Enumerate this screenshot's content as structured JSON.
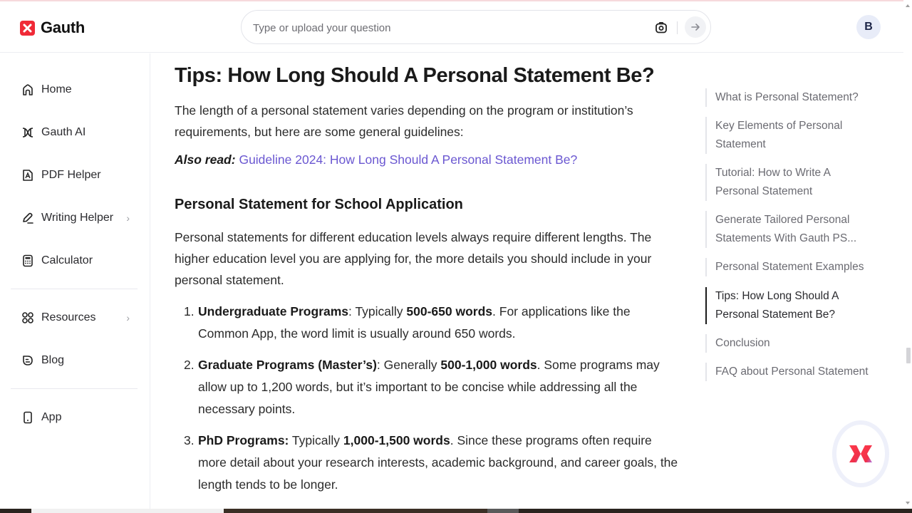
{
  "app": {
    "brand_name": "Gauth",
    "brand_color": "#f02a37",
    "link_color": "#6a57d1"
  },
  "header": {
    "search": {
      "placeholder": "Type or upload your question",
      "value": "",
      "camera_icon": "camera-icon",
      "send_icon": "arrow-right-icon"
    },
    "avatar_initial": "B"
  },
  "sidebar": {
    "items": [
      {
        "label": "Home",
        "icon": "home-icon",
        "has_chevron": false
      },
      {
        "label": "Gauth AI",
        "icon": "gauth-ai-icon",
        "has_chevron": false
      },
      {
        "label": "PDF Helper",
        "icon": "pdf-icon",
        "has_chevron": false
      },
      {
        "label": "Writing Helper",
        "icon": "pen-icon",
        "has_chevron": true
      },
      {
        "label": "Calculator",
        "icon": "calculator-icon",
        "has_chevron": false
      },
      {
        "label": "Resources",
        "icon": "grid-icon",
        "has_chevron": true
      },
      {
        "label": "Blog",
        "icon": "blog-icon",
        "has_chevron": false
      },
      {
        "label": "App",
        "icon": "phone-icon",
        "has_chevron": false
      }
    ],
    "chevron_glyph": "›"
  },
  "article": {
    "title": "Tips: How Long Should A Personal Statement Be?",
    "intro": "The length of a personal statement varies depending on the program or institution’s requirements, but here are some general guidelines:",
    "also_read_label": "Also read:",
    "also_read_link": "Guideline 2024: How Long Should A Personal Statement Be?",
    "section_heading": "Personal Statement for School Application",
    "section_paragraph": "Personal statements for different education levels always require different lengths. The higher education level you are applying for, the more details you should include in your personal statement.",
    "list": [
      {
        "number": "1.",
        "term": "Undergraduate Programs",
        "sep": ": Typically ",
        "range": "500-650 words",
        "rest": ". For applications like the Common App, the word limit is usually around 650 words."
      },
      {
        "number": "2.",
        "term": "Graduate Programs (Master’s)",
        "sep": ": Generally ",
        "range": "500-1,000 words",
        "rest": ". Some programs may allow up to 1,200 words, but it’s important to be concise while addressing all the necessary points."
      },
      {
        "number": "3.",
        "term": "PhD Programs:",
        "sep": " Typically ",
        "range": "1,000-1,500 words",
        "rest": ". Since these programs often require more detail about your research interests, academic background, and career goals, the length tends to be longer."
      }
    ]
  },
  "toc": {
    "items": [
      {
        "label": "What is Personal Statement?",
        "active": false
      },
      {
        "label": "Key Elements of Personal Statement",
        "active": false
      },
      {
        "label": "Tutorial: How to Write A Personal Statement",
        "active": false
      },
      {
        "label": "Generate Tailored Personal Statements With Gauth PS...",
        "active": false
      },
      {
        "label": "Personal Statement Examples",
        "active": false
      },
      {
        "label": "Tips: How Long Should A Personal Statement Be?",
        "active": true
      },
      {
        "label": "Conclusion",
        "active": false
      },
      {
        "label": "FAQ about Personal Statement",
        "active": false
      }
    ]
  },
  "floating_assistant": {
    "icon": "gauth-bot-icon"
  }
}
